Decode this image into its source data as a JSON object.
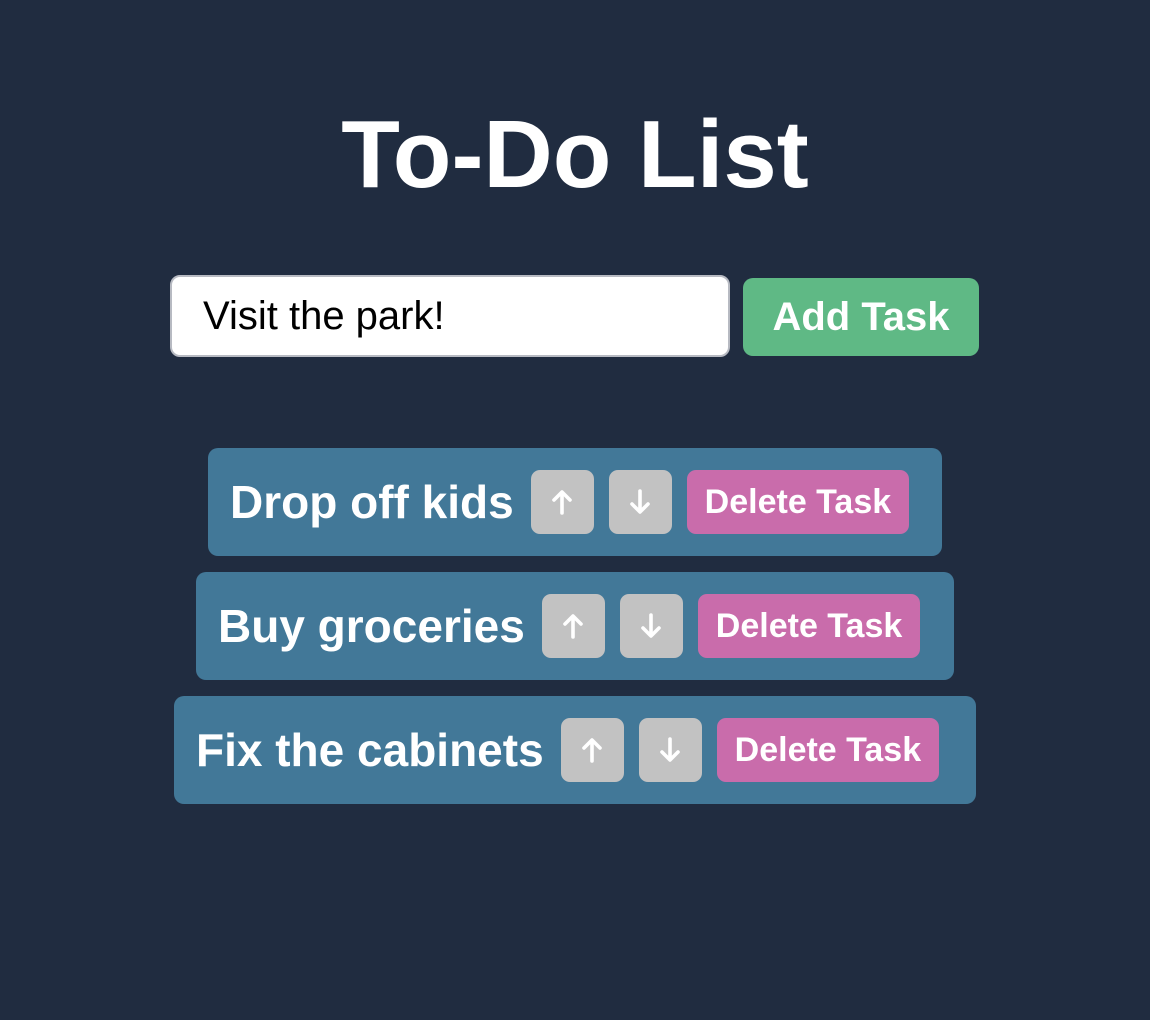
{
  "header": {
    "title": "To-Do List"
  },
  "new_task": {
    "value": "Visit the park!",
    "placeholder": "",
    "add_label": "Add Task"
  },
  "tasks": [
    {
      "text": "Drop off kids",
      "up_icon": "arrow-up-icon",
      "down_icon": "arrow-down-icon",
      "delete_label": "Delete Task"
    },
    {
      "text": "Buy groceries",
      "up_icon": "arrow-up-icon",
      "down_icon": "arrow-down-icon",
      "delete_label": "Delete Task"
    },
    {
      "text": "Fix the cabinets",
      "up_icon": "arrow-up-icon",
      "down_icon": "arrow-down-icon",
      "delete_label": "Delete Task"
    }
  ],
  "colors": {
    "background": "#202c40",
    "add_button": "#5fb985",
    "task_row": "#427898",
    "move_button": "#c2c2c2",
    "delete_button": "#c96cab",
    "text": "#ffffff"
  }
}
